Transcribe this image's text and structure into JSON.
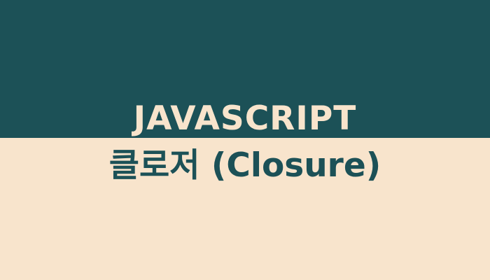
{
  "banner": {
    "title_line_1": "JAVASCRIPT",
    "title_line_2": "클로저 (Closure)"
  },
  "colors": {
    "top_band": "#1c5157",
    "bottom_band": "#f8e4cc",
    "title_line_1_text": "#f8e4cc",
    "title_line_2_text": "#1c5157"
  }
}
